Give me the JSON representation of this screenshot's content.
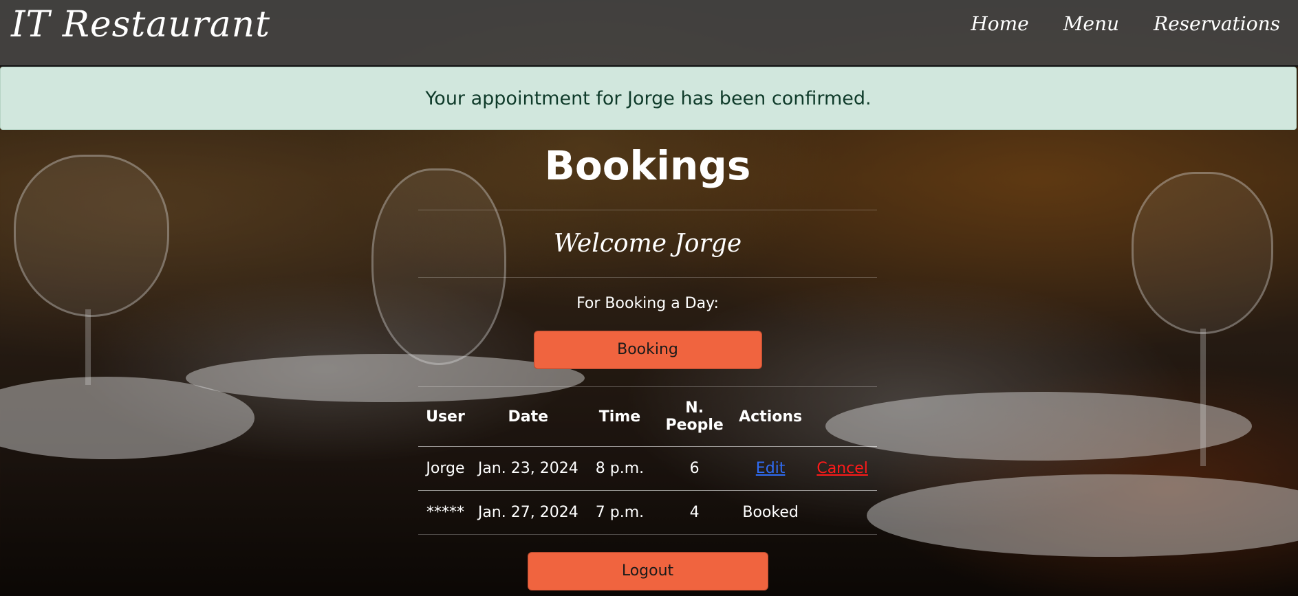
{
  "header": {
    "brand": "IT Restaurant",
    "nav": [
      {
        "label": "Home"
      },
      {
        "label": "Menu"
      },
      {
        "label": "Reservations"
      }
    ]
  },
  "alert": {
    "message": "Your appointment for Jorge has been confirmed.",
    "color": "#d1e7dd"
  },
  "main": {
    "title": "Bookings",
    "welcome": "Welcome Jorge",
    "booking_prompt": "For Booking a Day:",
    "booking_button": "Booking",
    "logout_button": "Logout",
    "button_color": "#f0643f"
  },
  "table": {
    "headers": [
      "User",
      "Date",
      "Time",
      "N. People",
      "Actions"
    ],
    "rows": [
      {
        "user": "Jorge",
        "date": "Jan. 23, 2024",
        "time": "8 p.m.",
        "people": "6",
        "edit": "Edit",
        "cancel": "Cancel"
      },
      {
        "user": "*****",
        "date": "Jan. 27, 2024",
        "time": "7 p.m.",
        "people": "4",
        "status": "Booked"
      }
    ]
  }
}
